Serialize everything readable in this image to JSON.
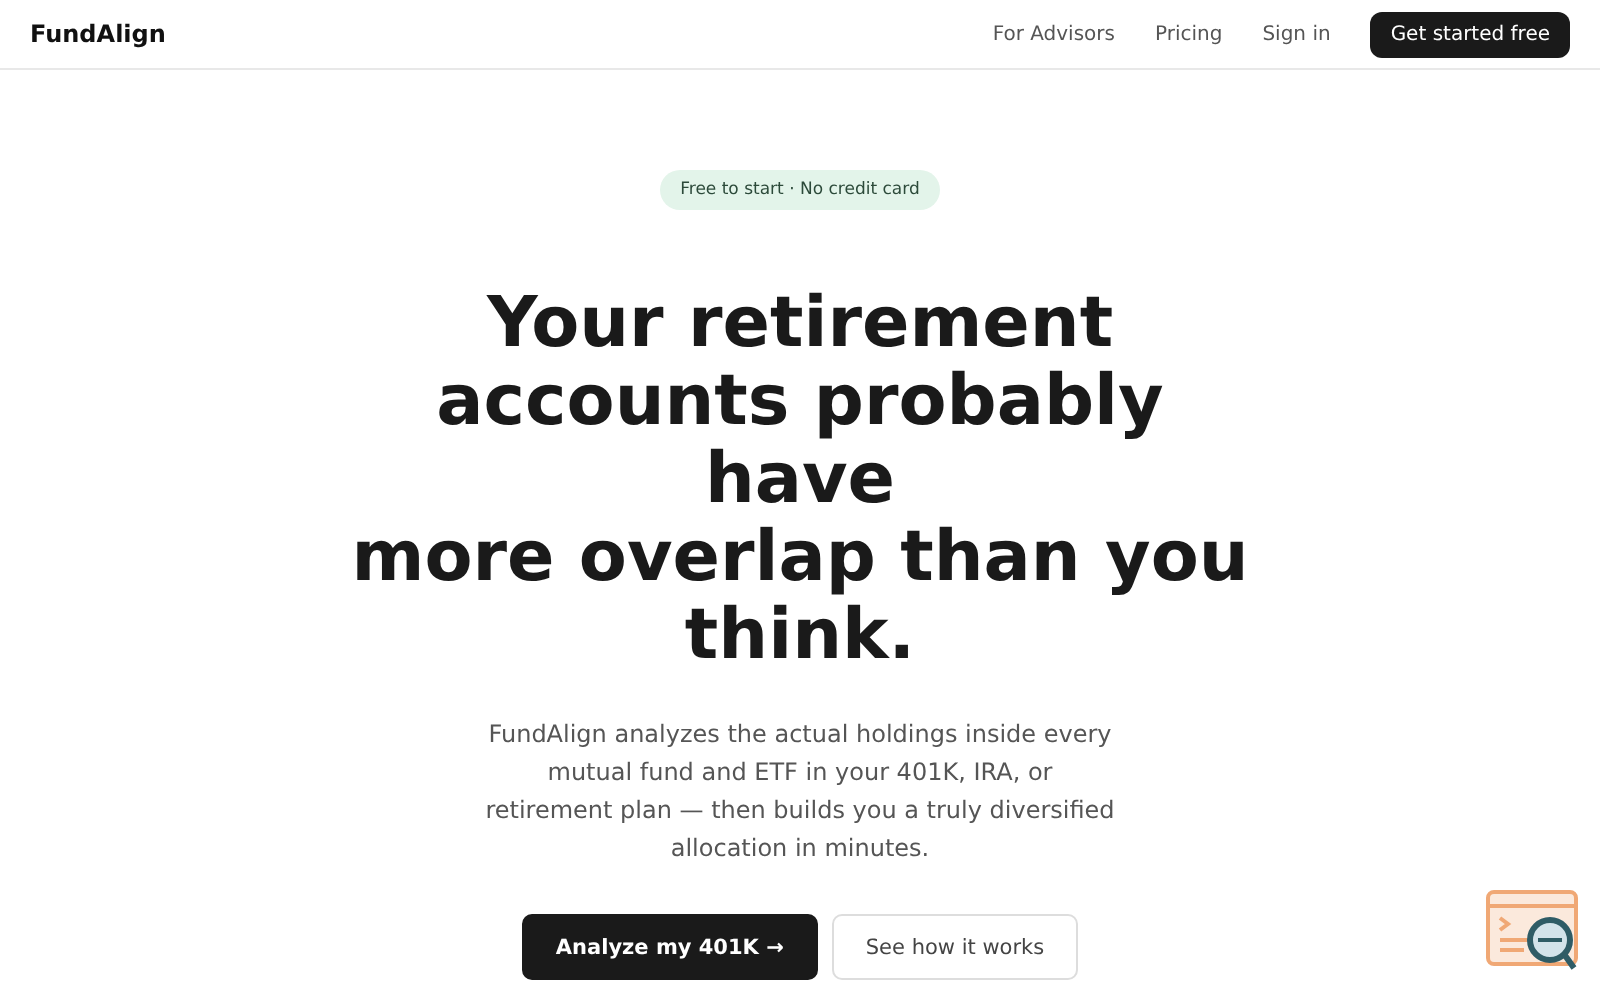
{
  "nav": {
    "logo": "FundAlign",
    "links": [
      "For Advisors",
      "Pricing",
      "Sign in"
    ],
    "cta": "Get started free"
  },
  "hero": {
    "badge": "Free to start · No credit card",
    "headline_lines": [
      "Your retirement",
      "accounts probably",
      "have",
      "more overlap than you",
      "think."
    ],
    "description": "FundAlign analyzes the actual holdings inside every mutual fund and ETF in your 401K, IRA, or retirement plan — then builds you a truly diversified allocation in minutes.",
    "buttons": [
      {
        "label": "Analyze my 401K →",
        "kind": "primary"
      },
      {
        "label": "See how it works",
        "kind": "secondary"
      }
    ]
  }
}
